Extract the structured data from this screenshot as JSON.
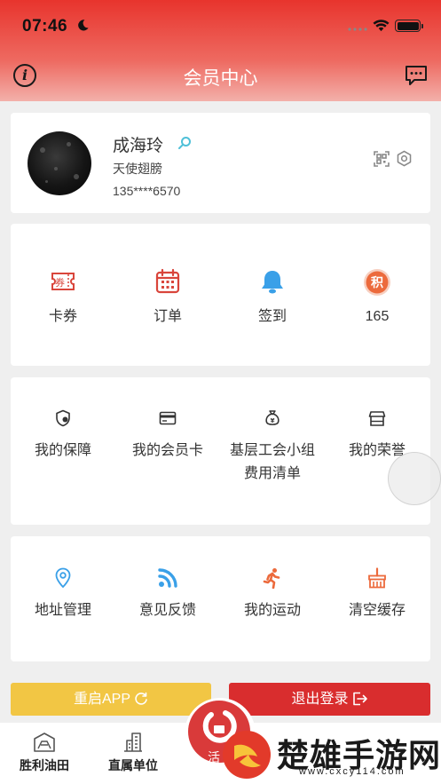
{
  "status_bar": {
    "time": "07:46"
  },
  "nav": {
    "title": "会员中心",
    "info_label": "i"
  },
  "profile": {
    "name": "成海玲",
    "title": "天使翅膀",
    "phone": "135****6570"
  },
  "quick_actions": [
    {
      "label": "卡券",
      "icon": "coupon-icon"
    },
    {
      "label": "订单",
      "icon": "calendar-icon"
    },
    {
      "label": "签到",
      "icon": "bell-icon"
    },
    {
      "label": "165",
      "icon": "points-icon",
      "badge": "积"
    }
  ],
  "menu1": [
    {
      "label": "我的保障",
      "icon": "shield-icon"
    },
    {
      "label": "我的会员卡",
      "icon": "card-icon"
    },
    {
      "label_line1": "基层工会小组",
      "label_line2": "费用清单",
      "icon": "money-bag-icon"
    },
    {
      "label": "我的荣誉",
      "icon": "store-icon"
    }
  ],
  "menu2": [
    {
      "label": "地址管理",
      "icon": "location-icon"
    },
    {
      "label": "意见反馈",
      "icon": "rss-icon"
    },
    {
      "label": "我的运动",
      "icon": "running-icon"
    },
    {
      "label": "清空缓存",
      "icon": "broom-icon"
    }
  ],
  "buttons": {
    "restart": "重启APP",
    "logout": "退出登录"
  },
  "tabbar": [
    {
      "label": "胜利油田",
      "icon": "oilfield-icon"
    },
    {
      "label": "直属单位",
      "icon": "building-icon"
    },
    {
      "label": "活",
      "icon": "activity-icon"
    }
  ],
  "watermark": {
    "text": "楚雄手游网",
    "url": "www.cxcy114.com"
  },
  "colors": {
    "brand_red": "#e8342d",
    "restart_yellow": "#f2c644",
    "logout_red": "#d92d2e",
    "icon_red": "#d9453b",
    "icon_blue": "#3aa0e8",
    "icon_orange": "#ec6a3c"
  }
}
